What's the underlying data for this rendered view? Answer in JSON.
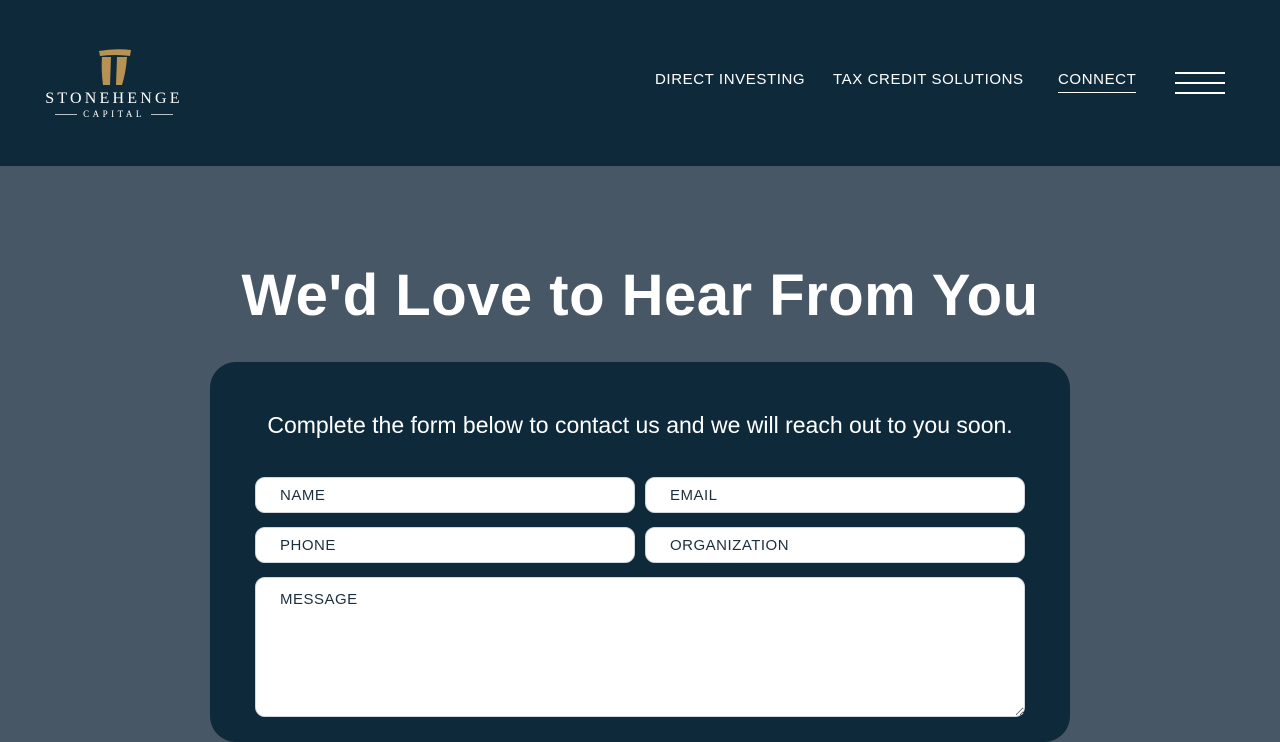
{
  "brand": {
    "name": "STONEHENGE",
    "subtitle": "CAPITAL",
    "logo_icon": "stonehenge-trilithon-icon",
    "accent_color": "#b89253"
  },
  "nav": {
    "items": [
      {
        "label": "DIRECT INVESTING"
      },
      {
        "label": "TAX CREDIT SOLUTIONS"
      },
      {
        "label": "CONNECT",
        "active": true
      }
    ],
    "menu_icon": "hamburger-menu-icon"
  },
  "hero": {
    "title": "We'd Love to Hear From You"
  },
  "form": {
    "intro": "Complete the form below to contact us and we will reach out to you soon.",
    "fields": {
      "name": {
        "placeholder": "NAME",
        "value": ""
      },
      "email": {
        "placeholder": "EMAIL",
        "value": ""
      },
      "phone": {
        "placeholder": "PHONE",
        "value": ""
      },
      "organization": {
        "placeholder": "ORGANIZATION",
        "value": ""
      },
      "message": {
        "placeholder": "MESSAGE",
        "value": ""
      }
    }
  },
  "colors": {
    "header_bg": "#0e2a3a",
    "page_bg": "#475766",
    "card_bg": "#0e2a3a"
  }
}
